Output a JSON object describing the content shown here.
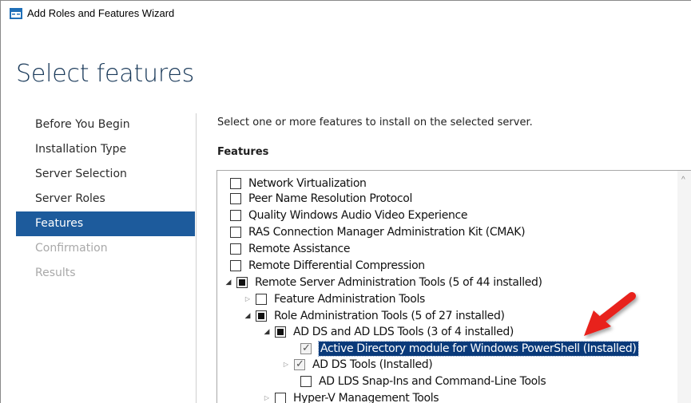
{
  "window": {
    "title": "Add Roles and Features Wizard"
  },
  "page": {
    "heading": "Select features",
    "intro": "Select one or more features to install on the selected server.",
    "features_label": "Features"
  },
  "nav": {
    "items": [
      {
        "label": "Before You Begin",
        "state": "normal"
      },
      {
        "label": "Installation Type",
        "state": "normal"
      },
      {
        "label": "Server Selection",
        "state": "normal"
      },
      {
        "label": "Server Roles",
        "state": "normal"
      },
      {
        "label": "Features",
        "state": "active"
      },
      {
        "label": "Confirmation",
        "state": "disabled"
      },
      {
        "label": "Results",
        "state": "disabled"
      }
    ]
  },
  "tree": {
    "items": [
      {
        "label": "Network Virtualization",
        "check": "none",
        "expander": "none"
      },
      {
        "label": "Peer Name Resolution Protocol",
        "check": "none",
        "expander": "none"
      },
      {
        "label": "Quality Windows Audio Video Experience",
        "check": "none",
        "expander": "none"
      },
      {
        "label": "RAS Connection Manager Administration Kit (CMAK)",
        "check": "none",
        "expander": "none"
      },
      {
        "label": "Remote Assistance",
        "check": "none",
        "expander": "none"
      },
      {
        "label": "Remote Differential Compression",
        "check": "none",
        "expander": "none"
      },
      {
        "label": "Remote Server Administration Tools (5 of 44 installed)",
        "check": "partial",
        "expander": "expanded"
      },
      {
        "label": "Feature Administration Tools",
        "check": "none",
        "expander": "collapsed"
      },
      {
        "label": "Role Administration Tools (5 of 27 installed)",
        "check": "partial",
        "expander": "expanded"
      },
      {
        "label": "AD DS and AD LDS Tools (3 of 4 installed)",
        "check": "partial",
        "expander": "expanded"
      },
      {
        "label": "Active Directory module for Windows PowerShell (Installed)",
        "check": "checked",
        "expander": "none",
        "selected": true
      },
      {
        "label": "AD DS Tools (Installed)",
        "check": "checked",
        "expander": "collapsed"
      },
      {
        "label": "AD LDS Snap-Ins and Command-Line Tools",
        "check": "none",
        "expander": "none"
      },
      {
        "label": "Hyper-V Management Tools",
        "check": "none",
        "expander": "collapsed"
      }
    ]
  },
  "colors": {
    "accent": "#1d5b9c",
    "selection": "#0a3a7a",
    "arrow": "#e8201c"
  }
}
